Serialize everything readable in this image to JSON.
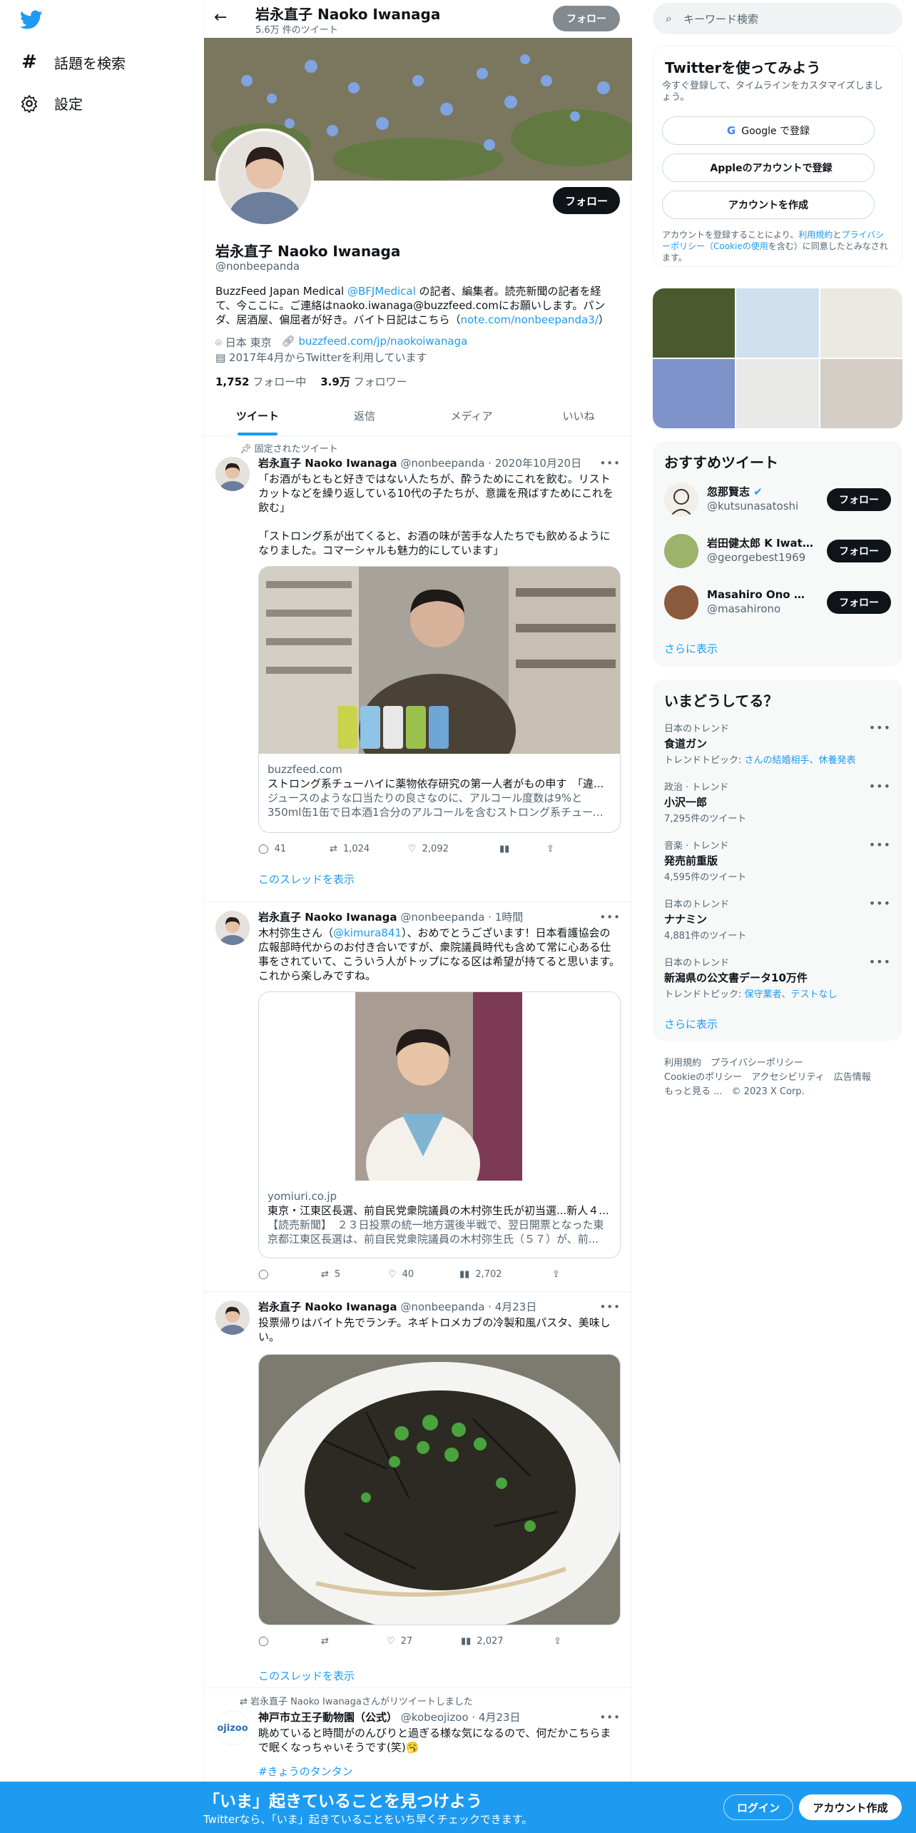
{
  "nav": {
    "explore_label": "話題を検索",
    "settings_label": "設定"
  },
  "header": {
    "name": "岩永直子 Naoko Iwanaga",
    "tweet_count": "5.6万 件のツイート",
    "follow_label": "フォロー"
  },
  "profile": {
    "name": "岩永直子 Naoko Iwanaga",
    "handle": "@nonbeepanda",
    "follow_label": "フォロー",
    "bio_pre": "BuzzFeed Japan Medical ",
    "bio_mention": "@BFJMedical",
    "bio_mid": " の記者、編集者。読売新聞の記者を経て、今ここに。ご連絡はnaoko.iwanaga@buzzfeed.comにお願いします。パンダ、居酒屋、偏屈者が好き。バイト日記はこちら（",
    "bio_link": "note.com/nonbeepanda3/",
    "bio_post": "）",
    "location": "日本 東京",
    "website": "buzzfeed.com/jp/naokoiwanaga",
    "joined": "2017年4月からTwitterを利用しています",
    "following_count": "1,752",
    "following_label": "フォロー中",
    "followers_count": "3.9万",
    "followers_label": "フォロワー"
  },
  "tabs": [
    "ツイート",
    "返信",
    "メディア",
    "いいね"
  ],
  "tweets": [
    {
      "pinned_label": "固定されたツイート",
      "name": "岩永直子 Naoko Iwanaga",
      "meta": "@nonbeepanda · 2020年10月20日",
      "text1": "「お酒がもともと好きではない人たちが、酔うためにこれを飲む。リストカットなどを繰り返している10代の子たちが、意識を飛ばすためにこれを飲む」",
      "text2": "「ストロング系が出てくると、お酒の味が苦手な人たちでも飲めるようになりました。コマーシャルも魅力的にしています」",
      "card_domain": "buzzfeed.com",
      "card_title": "ストロング系チューハイに薬物依存研究の第一人者がもの申す　「違...",
      "card_desc1": "ジュースのような口当たりの良さなのに、アルコール度数は9%と",
      "card_desc2": "350ml缶1缶で日本酒1合分のアルコールを含むストロング系チューハ...",
      "replies": "41",
      "retweets": "1,024",
      "likes": "2,092",
      "show_thread": "このスレッドを表示"
    },
    {
      "name": "岩永直子 Naoko Iwanaga",
      "meta": "@nonbeepanda · 1時間",
      "text_pre": "木村弥生さん（",
      "text_mention": "@kimura841",
      "text_post": "）、おめでとうございます！日本看護協会の広報部時代からのお付き合いですが、衆院議員時代も含めて常に心ある仕事をされていて、こういう人がトップになる区は希望が持てると思います。これから楽しみですね。",
      "card_domain": "yomiuri.co.jp",
      "card_title": "東京・江東区長選、前自民党衆院議員の木村弥生氏が初当選...新人４...",
      "card_desc1": "【読売新聞】　２３日投票の統一地方選後半戦で、翌日開票となった東",
      "card_desc2": "京都江東区長選は、前自民党衆院議員の木村弥生氏（５７）が、前...",
      "retweets": "5",
      "likes": "40",
      "views": "2,702"
    },
    {
      "name": "岩永直子 Naoko Iwanaga",
      "meta": "@nonbeepanda · 4月23日",
      "text": "投票帰りはバイト先でランチ。ネギトロメカブの冷製和風パスタ、美味しい。",
      "likes": "27",
      "views": "2,027",
      "show_thread": "このスレッドを表示"
    },
    {
      "retweet_label": "岩永直子 Naoko Iwanagaさんがリツイートしました",
      "name": "神戸市立王子動物園（公式）",
      "meta": "@kobeojizoo · 4月23日",
      "avatar_text": "ojizoo",
      "text": "眺めていると時間がのんびりと過ぎる様な気になるので、何だかこちらまで眠くなっちゃいそうです(笑)🥱",
      "hashtag": "#きょうのタンタン"
    }
  ],
  "right": {
    "search_placeholder": "キーワード検索",
    "signup_title": "Twitterを使ってみよう",
    "signup_sub": "今すぐ登録して、タイムラインをカスタマイズしましょう。",
    "google_label": "Google で登録",
    "apple_label": "Appleのアカウントで登録",
    "create_label": "アカウントを作成",
    "terms_pre": "アカウントを登録することにより、",
    "terms_link1": "利用規約",
    "terms_mid1": "と",
    "terms_link2": "プライバシーポリシー（Cookieの使用",
    "terms_post": "を含む）に同意したとみなされます。",
    "who_title": "おすすめツイート",
    "who": [
      {
        "name": "忽那賢志",
        "handle": "@kutsunasatoshi",
        "follow": "フォロー"
      },
      {
        "name": "岩田健太郎 K Iwata, ...",
        "handle": "@georgebest1969",
        "follow": "フォロー"
      },
      {
        "name": "Masahiro Ono 小野...",
        "handle": "@masahirono",
        "follow": "フォロー"
      }
    ],
    "who_more": "さらに表示",
    "trends_title": "いまどうしてる？",
    "trends": [
      {
        "ctx": "日本のトレンド",
        "name": "食道ガン",
        "sub_pre": "トレンドトピック: ",
        "sub_link": "さんの結婚相手、休養発表"
      },
      {
        "ctx": "政治 · トレンド",
        "name": "小沢一郎",
        "sub": "7,295件のツイート"
      },
      {
        "ctx": "音楽 · トレンド",
        "name": "発売前重版",
        "sub": "4,595件のツイート"
      },
      {
        "ctx": "日本のトレンド",
        "name": "ナナミン",
        "sub": "4,881件のツイート"
      },
      {
        "ctx": "日本のトレンド",
        "name": "新潟県の公文書データ10万件",
        "sub_pre": "トレンドトピック: ",
        "sub_link": "保守業者、テストなし"
      }
    ],
    "trends_more": "さらに表示",
    "footer": [
      "利用規約",
      "プライバシーポリシー",
      "Cookieのポリシー",
      "アクセシビリティ",
      "広告情報",
      "もっと見る ...",
      "© 2023 X Corp."
    ]
  },
  "bottom": {
    "title": "「いま」起きていることを見つけよう",
    "sub": "Twitterなら、「いま」起きていることをいち早くチェックできます。",
    "login": "ログイン",
    "signup": "アカウント作成"
  },
  "colors": {
    "accent": "#1d9bf0",
    "text": "#0f1419",
    "muted": "#536471"
  }
}
